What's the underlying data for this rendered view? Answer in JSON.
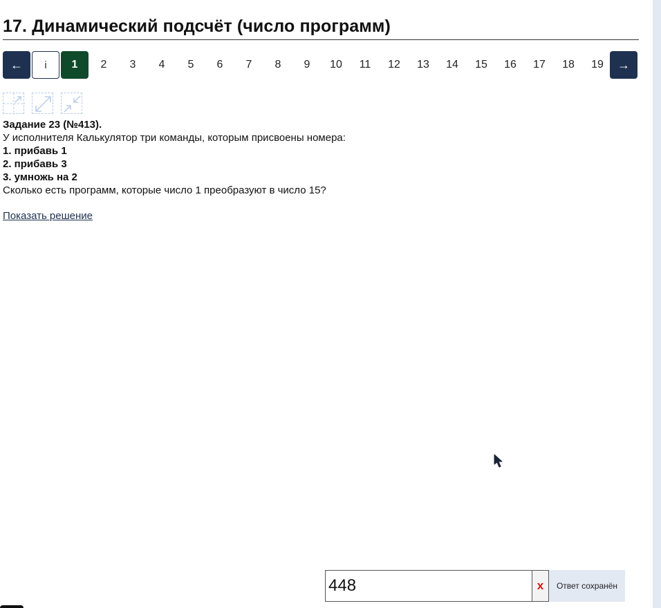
{
  "header": {
    "title": "17. Динамический подсчёт (число программ)"
  },
  "pager": {
    "prev_label": "←",
    "info_label": "i",
    "current_label": "1",
    "pages": [
      "2",
      "3",
      "4",
      "5",
      "6",
      "7",
      "8",
      "9",
      "10",
      "11",
      "12",
      "13",
      "14",
      "15",
      "16",
      "17",
      "18",
      "19"
    ],
    "next_label": "→"
  },
  "task": {
    "heading": "Задание 23 (№413).",
    "intro": "У исполнителя Калькулятор три команды, которым присвоены номера:",
    "commands": [
      "1. прибавь 1",
      "2. прибавь 3",
      "3. умножь на 2"
    ],
    "question": "Сколько есть программ, которые число 1 преобразуют в число 15?",
    "show_solution": "Показать решение"
  },
  "answer": {
    "value": "448",
    "clear_label": "x",
    "status": "Ответ сохранён"
  },
  "icons": {
    "tool_1": "resize-corner-icon",
    "tool_2": "expand-icon",
    "tool_3": "collapse-icon"
  },
  "colors": {
    "nav": "#1f3150",
    "current": "#0f4a2b",
    "clear": "#e01010",
    "status_bg": "#e3e9f3"
  }
}
